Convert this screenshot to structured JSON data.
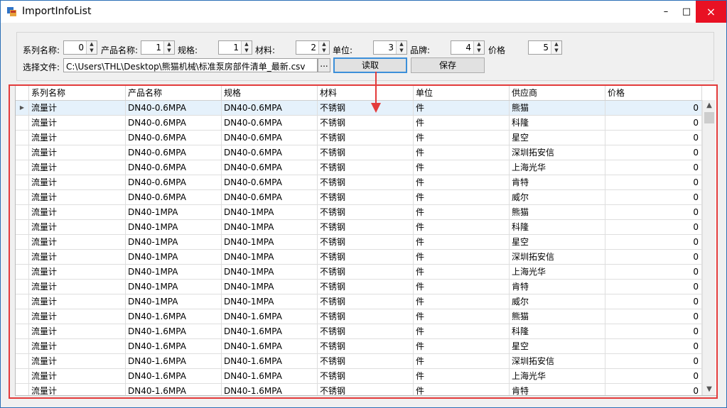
{
  "window": {
    "title": "ImportInfoList",
    "minimize_glyph": "–",
    "maximize_glyph": "□",
    "close_glyph": "×"
  },
  "mapping": {
    "fields": [
      {
        "label": "系列名称:",
        "value": "0"
      },
      {
        "label": "产品名称:",
        "value": "1"
      },
      {
        "label": "规格:",
        "value": "1"
      },
      {
        "label": "材料:",
        "value": "2"
      },
      {
        "label": "单位:",
        "value": "3"
      },
      {
        "label": "品牌:",
        "value": "4"
      },
      {
        "label": "价格",
        "value": "5"
      }
    ],
    "file_label": "选择文件:",
    "file_path": "C:\\Users\\THL\\Desktop\\熊猫机械\\标准泵房部件清单_最新.csv",
    "browse_label": "...",
    "read_label": "读取",
    "save_label": "保存"
  },
  "grid": {
    "columns": [
      "系列名称",
      "产品名称",
      "规格",
      "材料",
      "单位",
      "供应商",
      "价格"
    ],
    "rows": [
      [
        "流量计",
        "DN40-0.6MPA",
        "DN40-0.6MPA",
        "不锈钢",
        "件",
        "熊猫",
        "0"
      ],
      [
        "流量计",
        "DN40-0.6MPA",
        "DN40-0.6MPA",
        "不锈钢",
        "件",
        "科隆",
        "0"
      ],
      [
        "流量计",
        "DN40-0.6MPA",
        "DN40-0.6MPA",
        "不锈钢",
        "件",
        "星空",
        "0"
      ],
      [
        "流量计",
        "DN40-0.6MPA",
        "DN40-0.6MPA",
        "不锈钢",
        "件",
        "深圳拓安信",
        "0"
      ],
      [
        "流量计",
        "DN40-0.6MPA",
        "DN40-0.6MPA",
        "不锈钢",
        "件",
        "上海光华",
        "0"
      ],
      [
        "流量计",
        "DN40-0.6MPA",
        "DN40-0.6MPA",
        "不锈钢",
        "件",
        "肯特",
        "0"
      ],
      [
        "流量计",
        "DN40-0.6MPA",
        "DN40-0.6MPA",
        "不锈钢",
        "件",
        "威尔",
        "0"
      ],
      [
        "流量计",
        "DN40-1MPA",
        "DN40-1MPA",
        "不锈钢",
        "件",
        "熊猫",
        "0"
      ],
      [
        "流量计",
        "DN40-1MPA",
        "DN40-1MPA",
        "不锈钢",
        "件",
        "科隆",
        "0"
      ],
      [
        "流量计",
        "DN40-1MPA",
        "DN40-1MPA",
        "不锈钢",
        "件",
        "星空",
        "0"
      ],
      [
        "流量计",
        "DN40-1MPA",
        "DN40-1MPA",
        "不锈钢",
        "件",
        "深圳拓安信",
        "0"
      ],
      [
        "流量计",
        "DN40-1MPA",
        "DN40-1MPA",
        "不锈钢",
        "件",
        "上海光华",
        "0"
      ],
      [
        "流量计",
        "DN40-1MPA",
        "DN40-1MPA",
        "不锈钢",
        "件",
        "肯特",
        "0"
      ],
      [
        "流量计",
        "DN40-1MPA",
        "DN40-1MPA",
        "不锈钢",
        "件",
        "威尔",
        "0"
      ],
      [
        "流量计",
        "DN40-1.6MPA",
        "DN40-1.6MPA",
        "不锈钢",
        "件",
        "熊猫",
        "0"
      ],
      [
        "流量计",
        "DN40-1.6MPA",
        "DN40-1.6MPA",
        "不锈钢",
        "件",
        "科隆",
        "0"
      ],
      [
        "流量计",
        "DN40-1.6MPA",
        "DN40-1.6MPA",
        "不锈钢",
        "件",
        "星空",
        "0"
      ],
      [
        "流量计",
        "DN40-1.6MPA",
        "DN40-1.6MPA",
        "不锈钢",
        "件",
        "深圳拓安信",
        "0"
      ],
      [
        "流量计",
        "DN40-1.6MPA",
        "DN40-1.6MPA",
        "不锈钢",
        "件",
        "上海光华",
        "0"
      ],
      [
        "流量计",
        "DN40-1.6MPA",
        "DN40-1.6MPA",
        "不锈钢",
        "件",
        "肯特",
        "0"
      ]
    ],
    "selected_row": 0,
    "current_row_glyph": "▶",
    "scroll_up_glyph": "▲",
    "scroll_down_glyph": "▼"
  },
  "colors": {
    "annotation": "#e33b3b",
    "selection": "#e5f1fb",
    "close_button": "#e81123",
    "focus_border": "#3c8fd9"
  },
  "icons": {
    "app": "app-window-icon",
    "arrow": "red-arrow-annotation"
  }
}
